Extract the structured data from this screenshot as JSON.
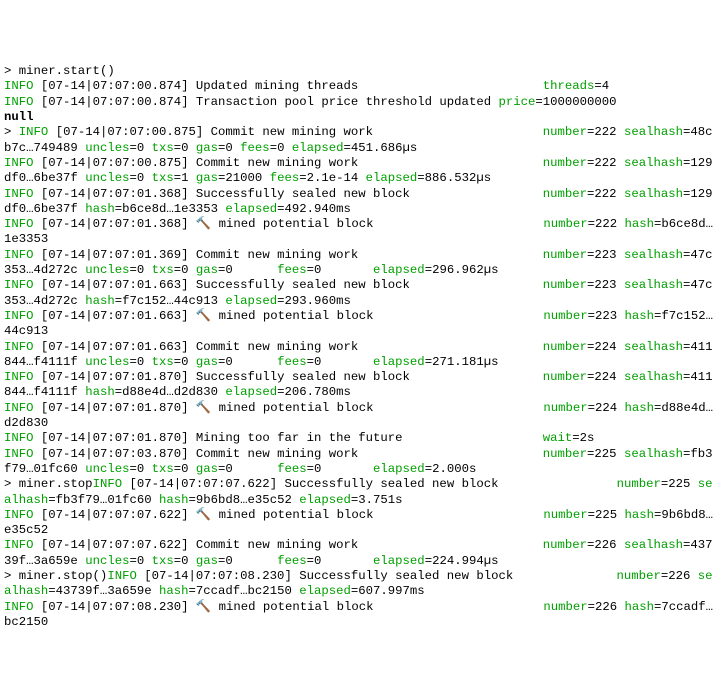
{
  "prompt": "> ",
  "cmds": {
    "start": "miner.start()",
    "stop1": "> miner.stop",
    "stop2": "> miner.stop()"
  },
  "null_line": "null",
  "icon": "🔨",
  "lines": [
    {
      "type": "cmd",
      "key": "start"
    },
    {
      "type": "log",
      "tag": "INFO",
      "ts": "[07-14|07:07:00.874]",
      "msg": "Updated mining threads",
      "pad": 24,
      "fields": [
        {
          "k": "threads",
          "v": "4"
        }
      ]
    },
    {
      "type": "log",
      "tag": "INFO",
      "ts": "[07-14|07:07:00.874]",
      "msg": "Transaction pool price threshold updated",
      "pad": 0,
      "fields": [
        {
          "k": "price",
          "v": "1000000000"
        }
      ]
    },
    {
      "type": "null"
    },
    {
      "type": "log",
      "lead": "> ",
      "tag": "INFO",
      "ts": "[07-14|07:07:00.875]",
      "msg": "Commit new mining work",
      "pad": 22,
      "fields": [
        {
          "k": "number",
          "v": "222"
        },
        {
          "k": "sealhash",
          "v": "48cb7c…749489"
        },
        {
          "k": "uncles",
          "v": "0"
        },
        {
          "k": "txs",
          "v": "0"
        },
        {
          "k": "gas",
          "v": "0"
        },
        {
          "k": "fees",
          "v": "0"
        },
        {
          "k": "elapsed",
          "v": "451.686µs"
        }
      ]
    },
    {
      "type": "log",
      "tag": "INFO",
      "ts": "[07-14|07:07:00.875]",
      "msg": "Commit new mining work",
      "pad": 24,
      "fields": [
        {
          "k": "number",
          "v": "222"
        },
        {
          "k": "sealhash",
          "v": "129df0…6be37f"
        },
        {
          "k": "uncles",
          "v": "0"
        },
        {
          "k": "txs",
          "v": "1"
        },
        {
          "k": "gas",
          "v": "21000"
        },
        {
          "k": "fees",
          "v": "2.1e-14"
        },
        {
          "k": "elapsed",
          "v": "886.532µs"
        }
      ]
    },
    {
      "type": "log",
      "tag": "INFO",
      "ts": "[07-14|07:07:01.368]",
      "msg": "Successfully sealed new block",
      "pad": 17,
      "fields": [
        {
          "k": "number",
          "v": "222"
        },
        {
          "k": "sealhash",
          "v": "129df0…6be37f"
        },
        {
          "k": "hash",
          "v": "b6ce8d…1e3353"
        },
        {
          "k": "elapsed",
          "v": "492.940ms"
        }
      ]
    },
    {
      "type": "log",
      "tag": "INFO",
      "ts": "[07-14|07:07:01.368]",
      "msg": "🔨 mined potential block",
      "pad": 22,
      "fields": [
        {
          "k": "number",
          "v": "222"
        },
        {
          "k": "hash",
          "v": "b6ce8d…1e3353"
        }
      ]
    },
    {
      "type": "log",
      "tag": "INFO",
      "ts": "[07-14|07:07:01.369]",
      "msg": "Commit new mining work",
      "pad": 24,
      "fields": [
        {
          "k": "number",
          "v": "223"
        },
        {
          "k": "sealhash",
          "v": "47c353…4d272c"
        },
        {
          "k": "uncles",
          "v": "0"
        },
        {
          "k": "txs",
          "v": "0"
        },
        {
          "k": "gas",
          "v": "0     "
        },
        {
          "k": "fees",
          "v": "0      "
        },
        {
          "k": "elapsed",
          "v": "296.962µs"
        }
      ]
    },
    {
      "type": "log",
      "tag": "INFO",
      "ts": "[07-14|07:07:01.663]",
      "msg": "Successfully sealed new block",
      "pad": 17,
      "fields": [
        {
          "k": "number",
          "v": "223"
        },
        {
          "k": "sealhash",
          "v": "47c353…4d272c"
        },
        {
          "k": "hash",
          "v": "f7c152…44c913"
        },
        {
          "k": "elapsed",
          "v": "293.960ms"
        }
      ]
    },
    {
      "type": "log",
      "tag": "INFO",
      "ts": "[07-14|07:07:01.663]",
      "msg": "🔨 mined potential block",
      "pad": 22,
      "fields": [
        {
          "k": "number",
          "v": "223"
        },
        {
          "k": "hash",
          "v": "f7c152…44c913"
        }
      ]
    },
    {
      "type": "log",
      "tag": "INFO",
      "ts": "[07-14|07:07:01.663]",
      "msg": "Commit new mining work",
      "pad": 24,
      "fields": [
        {
          "k": "number",
          "v": "224"
        },
        {
          "k": "sealhash",
          "v": "411844…f4111f"
        },
        {
          "k": "uncles",
          "v": "0"
        },
        {
          "k": "txs",
          "v": "0"
        },
        {
          "k": "gas",
          "v": "0     "
        },
        {
          "k": "fees",
          "v": "0      "
        },
        {
          "k": "elapsed",
          "v": "271.181µs"
        }
      ]
    },
    {
      "type": "log",
      "tag": "INFO",
      "ts": "[07-14|07:07:01.870]",
      "msg": "Successfully sealed new block",
      "pad": 17,
      "fields": [
        {
          "k": "number",
          "v": "224"
        },
        {
          "k": "sealhash",
          "v": "411844…f4111f"
        },
        {
          "k": "hash",
          "v": "d88e4d…d2d830"
        },
        {
          "k": "elapsed",
          "v": "206.780ms"
        }
      ]
    },
    {
      "type": "log",
      "tag": "INFO",
      "ts": "[07-14|07:07:01.870]",
      "msg": "🔨 mined potential block",
      "pad": 22,
      "fields": [
        {
          "k": "number",
          "v": "224"
        },
        {
          "k": "hash",
          "v": "d88e4d…d2d830"
        }
      ]
    },
    {
      "type": "log",
      "tag": "INFO",
      "ts": "[07-14|07:07:01.870]",
      "msg": "Mining too far in the future",
      "pad": 18,
      "fields": [
        {
          "k": "wait",
          "v": "2s"
        }
      ]
    },
    {
      "type": "log",
      "tag": "INFO",
      "ts": "[07-14|07:07:03.870]",
      "msg": "Commit new mining work",
      "pad": 24,
      "fields": [
        {
          "k": "number",
          "v": "225"
        },
        {
          "k": "sealhash",
          "v": "fb3f79…01fc60"
        },
        {
          "k": "uncles",
          "v": "0"
        },
        {
          "k": "txs",
          "v": "0"
        },
        {
          "k": "gas",
          "v": "0     "
        },
        {
          "k": "fees",
          "v": "0      "
        },
        {
          "k": "elapsed",
          "v": "2.000s"
        }
      ]
    },
    {
      "type": "inline_cmd",
      "key": "stop1",
      "tag": "INFO",
      "ts": "[07-14|07:07:07.622]",
      "msg": "Successfully sealed new block",
      "pad": 15,
      "fields": [
        {
          "k": "number",
          "v": "225"
        },
        {
          "k": "sealhash",
          "v": "fb3f79…01fc60"
        },
        {
          "k": "hash",
          "v": "9b6bd8…e35c52"
        },
        {
          "k": "elapsed",
          "v": "3.751s"
        }
      ]
    },
    {
      "type": "log",
      "tag": "INFO",
      "ts": "[07-14|07:07:07.622]",
      "msg": "🔨 mined potential block",
      "pad": 22,
      "fields": [
        {
          "k": "number",
          "v": "225"
        },
        {
          "k": "hash",
          "v": "9b6bd8…e35c52"
        }
      ]
    },
    {
      "type": "log",
      "tag": "INFO",
      "ts": "[07-14|07:07:07.622]",
      "msg": "Commit new mining work",
      "pad": 24,
      "fields": [
        {
          "k": "number",
          "v": "226"
        },
        {
          "k": "sealhash",
          "v": "43739f…3a659e"
        },
        {
          "k": "uncles",
          "v": "0"
        },
        {
          "k": "txs",
          "v": "0"
        },
        {
          "k": "gas",
          "v": "0     "
        },
        {
          "k": "fees",
          "v": "0      "
        },
        {
          "k": "elapsed",
          "v": "224.994µs"
        }
      ]
    },
    {
      "type": "inline_cmd",
      "key": "stop2",
      "tag": "INFO",
      "ts": "[07-14|07:07:08.230]",
      "msg": "Successfully sealed new block",
      "pad": 13,
      "fields": [
        {
          "k": "number",
          "v": "226"
        },
        {
          "k": "sealhash",
          "v": "43739f…3a659e"
        },
        {
          "k": "hash",
          "v": "7ccadf…bc2150"
        },
        {
          "k": "elapsed",
          "v": "607.997ms"
        }
      ]
    },
    {
      "type": "log",
      "tag": "INFO",
      "ts": "[07-14|07:07:08.230]",
      "msg": "🔨 mined potential block",
      "pad": 22,
      "fields": [
        {
          "k": "number",
          "v": "226"
        },
        {
          "k": "hash",
          "v": "7ccadf…bc2150"
        }
      ]
    }
  ]
}
